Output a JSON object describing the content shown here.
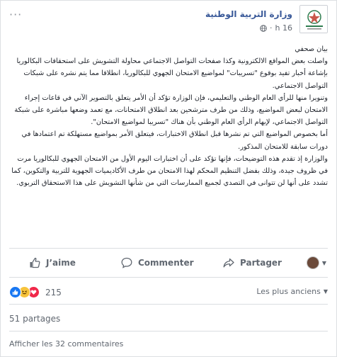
{
  "header": {
    "page_name": "وزارة التربية الوطنية",
    "timestamp": "16 h",
    "audience_icon": "globe-icon"
  },
  "post": {
    "paragraphs": [
      "بيان صحفي",
      "واصلت بعض المواقع الالكترونية وكذا صفحات التواصل الاجتماعي محاولة التشويش على استحقاقات البكالوريا بإشاعة أخبار تفيد بوقوع \"تسريبات\" لمواضيع الامتحان الجهوي للبكالوريا، انطلاقا مما يتم نشره على شبكات التواصل الاجتماعي.",
      "وتنويرا منها للرأي العام الوطني والتعليمي، فإن الوزارة تؤكد أن الأمر يتعلق بالتصوير الآني في قاعات إجراء الامتحان لبعض المواضيع، وذلك من طرف مترشحين بعد انطلاق الامتحانات، مع تعمد وضعها مباشرة على شبكة التواصل الاجتماعي، لإيهام الرأي العام الوطني بأن هناك \"تسريبا لمواضيع الامتحان\".",
      "أما بخصوص المواضيع التي تم نشرها قبل انطلاق الاختبارات، فيتعلق الأمر بمواضيع مستهلكة تم اعتمادها في دورات سابقة للامتحان المذكور.",
      "والوزارة إذ تقدم هذه التوضيحات، فإنها تؤكد على أن اختبارات اليوم الأول من الامتحان الجهوي للبكالوريا مرت في ظروف جيدة، وذلك بفضل التنظيم المحكم لهذا الامتحان من طرف الأكاديميات الجهوية للتربية والتكوين، كما تشدد على أنها لن تتوانى في التصدي لجميع الممارسات التي من شأنها التشويش على هذا الاستحقاق التربوي."
    ]
  },
  "actions": {
    "like": "J’aime",
    "comment": "Commenter",
    "share": "Partager"
  },
  "stats": {
    "reactions_count": "215",
    "sort_label": "Les plus anciens",
    "shares": "51 partages",
    "view_comments": "Afficher les 32 commentaires"
  },
  "colors": {
    "link": "#385898",
    "secondary_text": "#606770",
    "like_blue": "#1877f2",
    "love_red": "#f0284a",
    "haha_yellow": "#f7c33b"
  }
}
